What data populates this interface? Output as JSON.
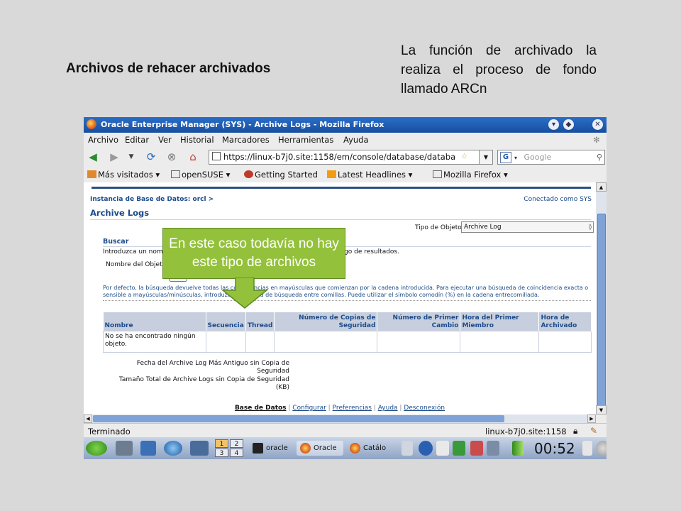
{
  "slide": {
    "title": "Archivos de rehacer archivados",
    "note": "La función de archivado la realiza el proceso de fondo llamado ARCn"
  },
  "callout": {
    "text": "En este caso todavía no hay este tipo de archivos",
    "color": "#94c13c"
  },
  "window": {
    "title": "Oracle Enterprise Manager (SYS) - Archive Logs - Mozilla Firefox",
    "buttons": [
      "minimize-icon",
      "maximize-icon",
      "close-icon"
    ]
  },
  "menu": [
    "Archivo",
    "Editar",
    "Ver",
    "Historial",
    "Marcadores",
    "Herramientas",
    "Ayuda"
  ],
  "nav": {
    "url": "https://linux-b7j0.site:1158/em/console/database/databa",
    "search_placeholder": "Google"
  },
  "bookmarks": [
    "Más visitados ▾",
    "openSUSE ▾",
    "Getting Started",
    "Latest Headlines ▾",
    "Mozilla Firefox ▾"
  ],
  "page": {
    "breadcrumb": "Instancia de Base de Datos: orcl  >",
    "connected": "Conectado como SYS",
    "heading": "Archive Logs",
    "object_type_label": "Tipo de Objeto",
    "object_type_value": "Archive Log",
    "search_heading": "Buscar",
    "intro_left": "Introduzca un nom",
    "intro_right": "rego de resultados.",
    "name_label": "Nombre del Objet",
    "hint": "Por defecto, la búsqueda devuelve todas las coincidencias en mayúsculas que comienzan por la cadena introducida. Para ejecutar una búsqueda de coincidencia exacta o sensible a mayúsculas/minúsculas, introduzca la cadena de búsqueda entre comillas. Puede utilizar el símbolo comodín (%) en la cadena entrecomillada.",
    "table": {
      "headers": [
        "Nombre",
        "Secuencia",
        "Thread",
        "Número de Copias de Seguridad",
        "Número de Primer Cambio",
        "Hora del Primer Miembro",
        "Hora de Archivado"
      ],
      "empty": "No se ha encontrado ningún objeto."
    },
    "summary_oldest": "Fecha del Archive Log Más Antiguo sin Copia de Seguridad",
    "summary_size": "Tamaño Total de Archive Logs sin Copia de Seguridad (KB)",
    "footer": {
      "current": "Base de Datos",
      "links": [
        "Configurar",
        "Preferencias",
        "Ayuda",
        "Desconexión"
      ]
    }
  },
  "status": {
    "left": "Terminado",
    "right": "linux-b7j0.site:1158"
  },
  "taskbar": {
    "pager": [
      "1",
      "2",
      "3",
      "4"
    ],
    "tasks": [
      "oracle",
      "Oracle",
      "Catálo"
    ],
    "clock": "00:52"
  }
}
